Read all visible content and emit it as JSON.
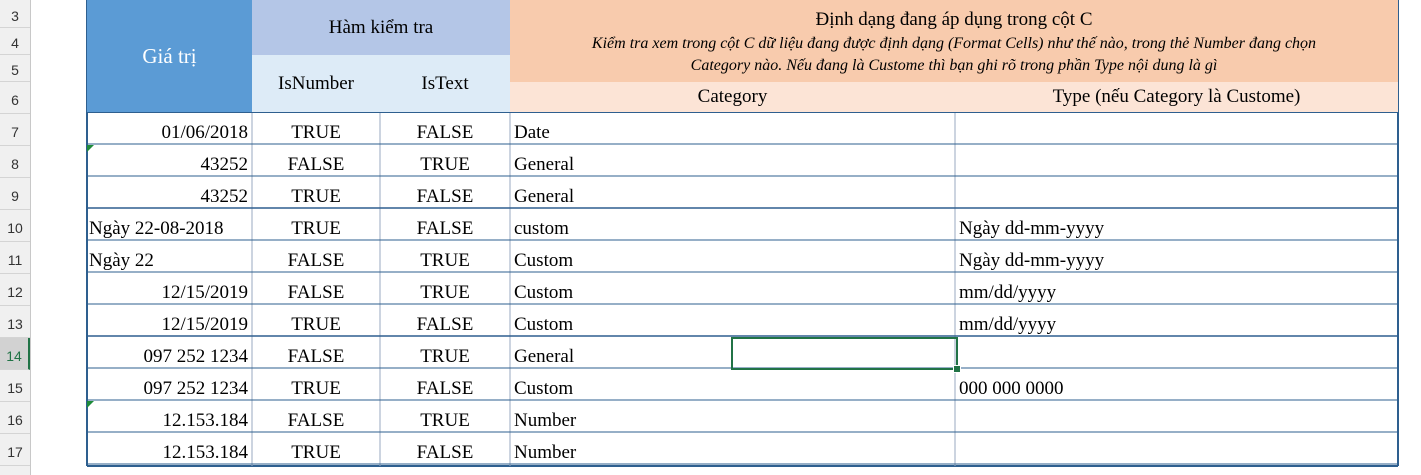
{
  "row_numbers": [
    "3",
    "4",
    "5",
    "6",
    "7",
    "8",
    "9",
    "10",
    "11",
    "12",
    "13",
    "14",
    "15",
    "16",
    "17"
  ],
  "selected_row": "14",
  "header": {
    "gia_tri": "Giá trị",
    "ham_kiem_tra": "Hàm kiểm tra",
    "isnumber": "IsNumber",
    "istext": "IsText",
    "dinh_dang_title": "Định dạng đang áp dụng trong cột C",
    "dinh_dang_note1": "Kiểm tra xem trong cột C dữ liệu đang được định dạng (Format Cells) như thế nào, trong thẻ Number đang chọn",
    "dinh_dang_note2": "Category nào. Nếu đang là Custome thì bạn ghi rõ trong phần Type nội dung là gì",
    "category": "Category",
    "type": "Type (nếu Category là Custome)"
  },
  "rows": [
    {
      "value": "01/06/2018",
      "isnumber": "TRUE",
      "istext": "FALSE",
      "category": "Date",
      "type": ""
    },
    {
      "value": "43252",
      "isnumber": "FALSE",
      "istext": "TRUE",
      "category": "General",
      "type": ""
    },
    {
      "value": "43252",
      "isnumber": "TRUE",
      "istext": "FALSE",
      "category": "General",
      "type": ""
    },
    {
      "value": "Ngày 22-08-2018",
      "isnumber": "TRUE",
      "istext": "FALSE",
      "category": "custom",
      "type": "Ngày dd-mm-yyyy"
    },
    {
      "value": "Ngày 22",
      "isnumber": "FALSE",
      "istext": "TRUE",
      "category": "Custom",
      "type": "Ngày dd-mm-yyyy"
    },
    {
      "value": "12/15/2019",
      "isnumber": "FALSE",
      "istext": "TRUE",
      "category": "Custom",
      "type": "mm/dd/yyyy"
    },
    {
      "value": "12/15/2019",
      "isnumber": "TRUE",
      "istext": "FALSE",
      "category": "Custom",
      "type": "mm/dd/yyyy"
    },
    {
      "value": "097 252 1234",
      "isnumber": "FALSE",
      "istext": "TRUE",
      "category": "General",
      "type": ""
    },
    {
      "value": "097 252 1234",
      "isnumber": "TRUE",
      "istext": "FALSE",
      "category": "Custom",
      "type": "000 000 0000"
    },
    {
      "value": "12.153.184",
      "isnumber": "FALSE",
      "istext": "TRUE",
      "category": "Number",
      "type": ""
    },
    {
      "value": "12.153.184",
      "isnumber": "TRUE",
      "istext": "FALSE",
      "category": "Number",
      "type": ""
    }
  ],
  "value_align": [
    "right",
    "right",
    "right",
    "left",
    "left",
    "right",
    "right",
    "right",
    "right",
    "right",
    "right"
  ],
  "colors": {
    "header_blue": "#5b9bd5",
    "header_light_blue": "#b4c6e7",
    "header_orange": "#f8cbad",
    "border": "#2e5f8f",
    "selection": "#217346"
  }
}
